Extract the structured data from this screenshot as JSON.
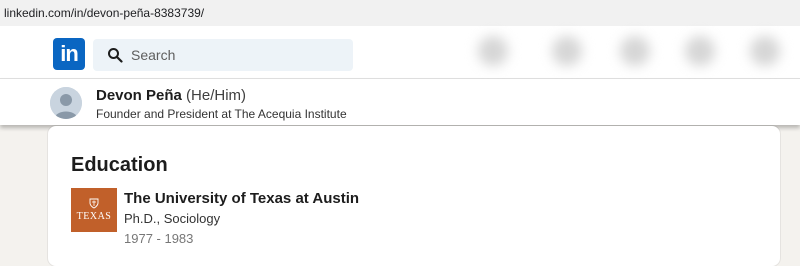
{
  "browser": {
    "url": "linkedin.com/in/devon-peña-8383739/"
  },
  "nav": {
    "logo_text": "in",
    "search_placeholder": "Search"
  },
  "profile": {
    "name": "Devon Peña",
    "pronouns": "(He/Him)",
    "headline": "Founder and President at The Acequia Institute"
  },
  "education": {
    "title": "Education",
    "entries": [
      {
        "logo_text": "TEXAS",
        "school": "The University of Texas at Austin",
        "degree": "Ph.D., Sociology",
        "years": "1977 - 1983"
      }
    ]
  },
  "colors": {
    "linkedin_blue": "#0a66c2",
    "ut_orange": "#c1602a",
    "search_bg": "#edf3f8"
  }
}
